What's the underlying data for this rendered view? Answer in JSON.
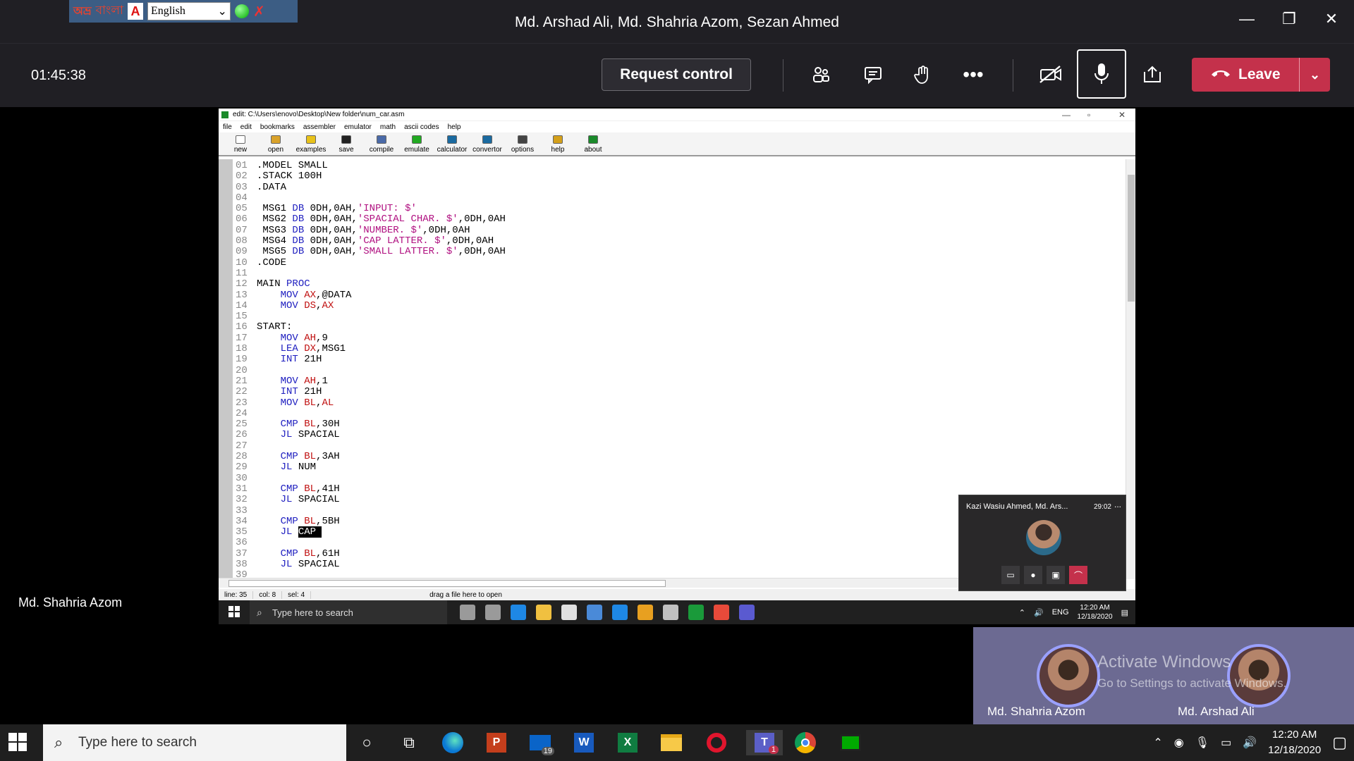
{
  "window": {
    "title": "Md. Arshad Ali, Md. Shahria Azom, Sezan Ahmed",
    "minimize": "—",
    "restore": "❐",
    "close": "✕"
  },
  "lang_bar": {
    "logo": "অভ্র",
    "name": "বাংলা",
    "adobe": "A",
    "selected": "English"
  },
  "call": {
    "timer": "01:45:38",
    "request_control": "Request control",
    "leave": "Leave",
    "presenter_name": "Md. Shahria Azom"
  },
  "editor": {
    "title": "edit: C:\\Users\\enovo\\Desktop\\New folder\\num_car.asm",
    "menu": [
      "file",
      "edit",
      "bookmarks",
      "assembler",
      "emulator",
      "math",
      "ascii codes",
      "help"
    ],
    "tools": [
      {
        "label": "new",
        "color": "#ffffff"
      },
      {
        "label": "open",
        "color": "#d9a22a"
      },
      {
        "label": "examples",
        "color": "#e8c21a"
      },
      {
        "label": "save",
        "color": "#222222"
      },
      {
        "label": "compile",
        "color": "#4a6aa8"
      },
      {
        "label": "emulate",
        "color": "#22aa22"
      },
      {
        "label": "calculator",
        "color": "#1a6aa0"
      },
      {
        "label": "convertor",
        "color": "#1a6aa0"
      },
      {
        "label": "options",
        "color": "#444444"
      },
      {
        "label": "help",
        "color": "#d4a01a"
      },
      {
        "label": "about",
        "color": "#1a8a2a"
      }
    ],
    "lines": [
      [
        {
          "t": ".MODEL SMALL",
          "c": "#000"
        }
      ],
      [
        {
          "t": ".STACK 100H",
          "c": "#000"
        }
      ],
      [
        {
          "t": ".DATA",
          "c": "#000"
        }
      ],
      [],
      [
        {
          "t": " MSG1 ",
          "c": "#000"
        },
        {
          "t": "DB",
          "c": "#2020c0"
        },
        {
          "t": " 0DH,0AH,",
          "c": "#000"
        },
        {
          "t": "'INPUT: $'",
          "c": "#b01080"
        }
      ],
      [
        {
          "t": " MSG2 ",
          "c": "#000"
        },
        {
          "t": "DB",
          "c": "#2020c0"
        },
        {
          "t": " 0DH,0AH,",
          "c": "#000"
        },
        {
          "t": "'SPACIAL CHAR. $'",
          "c": "#b01080"
        },
        {
          "t": ",0DH,0AH",
          "c": "#000"
        }
      ],
      [
        {
          "t": " MSG3 ",
          "c": "#000"
        },
        {
          "t": "DB",
          "c": "#2020c0"
        },
        {
          "t": " 0DH,0AH,",
          "c": "#000"
        },
        {
          "t": "'NUMBER. $'",
          "c": "#b01080"
        },
        {
          "t": ",0DH,0AH",
          "c": "#000"
        }
      ],
      [
        {
          "t": " MSG4 ",
          "c": "#000"
        },
        {
          "t": "DB",
          "c": "#2020c0"
        },
        {
          "t": " 0DH,0AH,",
          "c": "#000"
        },
        {
          "t": "'CAP LATTER. $'",
          "c": "#b01080"
        },
        {
          "t": ",0DH,0AH",
          "c": "#000"
        }
      ],
      [
        {
          "t": " MSG5 ",
          "c": "#000"
        },
        {
          "t": "DB",
          "c": "#2020c0"
        },
        {
          "t": " 0DH,0AH,",
          "c": "#000"
        },
        {
          "t": "'SMALL LATTER. $'",
          "c": "#b01080"
        },
        {
          "t": ",0DH,0AH",
          "c": "#000"
        }
      ],
      [
        {
          "t": ".CODE",
          "c": "#000"
        }
      ],
      [],
      [
        {
          "t": "MAIN ",
          "c": "#000"
        },
        {
          "t": "PROC",
          "c": "#2020c0"
        }
      ],
      [
        {
          "t": "    ",
          "c": "#000"
        },
        {
          "t": "MOV",
          "c": "#2020c0"
        },
        {
          "t": " ",
          "c": "#000"
        },
        {
          "t": "AX",
          "c": "#c01010"
        },
        {
          "t": ",@DATA",
          "c": "#000"
        }
      ],
      [
        {
          "t": "    ",
          "c": "#000"
        },
        {
          "t": "MOV",
          "c": "#2020c0"
        },
        {
          "t": " ",
          "c": "#000"
        },
        {
          "t": "DS",
          "c": "#c01010"
        },
        {
          "t": ",",
          "c": "#000"
        },
        {
          "t": "AX",
          "c": "#c01010"
        }
      ],
      [],
      [
        {
          "t": "START:",
          "c": "#000"
        }
      ],
      [
        {
          "t": "    ",
          "c": "#000"
        },
        {
          "t": "MOV",
          "c": "#2020c0"
        },
        {
          "t": " ",
          "c": "#000"
        },
        {
          "t": "AH",
          "c": "#c01010"
        },
        {
          "t": ",9",
          "c": "#000"
        }
      ],
      [
        {
          "t": "    ",
          "c": "#000"
        },
        {
          "t": "LEA",
          "c": "#2020c0"
        },
        {
          "t": " ",
          "c": "#000"
        },
        {
          "t": "DX",
          "c": "#c01010"
        },
        {
          "t": ",MSG1",
          "c": "#000"
        }
      ],
      [
        {
          "t": "    ",
          "c": "#000"
        },
        {
          "t": "INT",
          "c": "#2020c0"
        },
        {
          "t": " 21H",
          "c": "#000"
        }
      ],
      [],
      [
        {
          "t": "    ",
          "c": "#000"
        },
        {
          "t": "MOV",
          "c": "#2020c0"
        },
        {
          "t": " ",
          "c": "#000"
        },
        {
          "t": "AH",
          "c": "#c01010"
        },
        {
          "t": ",1",
          "c": "#000"
        }
      ],
      [
        {
          "t": "    ",
          "c": "#000"
        },
        {
          "t": "INT",
          "c": "#2020c0"
        },
        {
          "t": " 21H",
          "c": "#000"
        }
      ],
      [
        {
          "t": "    ",
          "c": "#000"
        },
        {
          "t": "MOV",
          "c": "#2020c0"
        },
        {
          "t": " ",
          "c": "#000"
        },
        {
          "t": "BL",
          "c": "#c01010"
        },
        {
          "t": ",",
          "c": "#000"
        },
        {
          "t": "AL",
          "c": "#c01010"
        }
      ],
      [],
      [
        {
          "t": "    ",
          "c": "#000"
        },
        {
          "t": "CMP",
          "c": "#2020c0"
        },
        {
          "t": " ",
          "c": "#000"
        },
        {
          "t": "BL",
          "c": "#c01010"
        },
        {
          "t": ",30H",
          "c": "#000"
        }
      ],
      [
        {
          "t": "    ",
          "c": "#000"
        },
        {
          "t": "JL",
          "c": "#2020c0"
        },
        {
          "t": " SPACIAL",
          "c": "#000"
        }
      ],
      [],
      [
        {
          "t": "    ",
          "c": "#000"
        },
        {
          "t": "CMP",
          "c": "#2020c0"
        },
        {
          "t": " ",
          "c": "#000"
        },
        {
          "t": "BL",
          "c": "#c01010"
        },
        {
          "t": ",3AH",
          "c": "#000"
        }
      ],
      [
        {
          "t": "    ",
          "c": "#000"
        },
        {
          "t": "JL",
          "c": "#2020c0"
        },
        {
          "t": " NUM",
          "c": "#000"
        }
      ],
      [],
      [
        {
          "t": "    ",
          "c": "#000"
        },
        {
          "t": "CMP",
          "c": "#2020c0"
        },
        {
          "t": " ",
          "c": "#000"
        },
        {
          "t": "BL",
          "c": "#c01010"
        },
        {
          "t": ",41H",
          "c": "#000"
        }
      ],
      [
        {
          "t": "    ",
          "c": "#000"
        },
        {
          "t": "JL",
          "c": "#2020c0"
        },
        {
          "t": " SPACIAL",
          "c": "#000"
        }
      ],
      [],
      [
        {
          "t": "    ",
          "c": "#000"
        },
        {
          "t": "CMP",
          "c": "#2020c0"
        },
        {
          "t": " ",
          "c": "#000"
        },
        {
          "t": "BL",
          "c": "#c01010"
        },
        {
          "t": ",5BH",
          "c": "#000"
        }
      ],
      [
        {
          "t": "    ",
          "c": "#000"
        },
        {
          "t": "JL",
          "c": "#2020c0"
        },
        {
          "t": " ",
          "c": "#000"
        },
        {
          "t": "CAP ",
          "c": "#fff",
          "sel": true
        }
      ],
      [],
      [
        {
          "t": "    ",
          "c": "#000"
        },
        {
          "t": "CMP",
          "c": "#2020c0"
        },
        {
          "t": " ",
          "c": "#000"
        },
        {
          "t": "BL",
          "c": "#c01010"
        },
        {
          "t": ",61H",
          "c": "#000"
        }
      ],
      [
        {
          "t": "    ",
          "c": "#000"
        },
        {
          "t": "JL",
          "c": "#2020c0"
        },
        {
          "t": " SPACIAL",
          "c": "#000"
        }
      ],
      []
    ],
    "status": {
      "line": "line: 35",
      "col": "col: 8",
      "sel": "sel: 4",
      "hint": "drag a file here to open"
    }
  },
  "inner_taskbar": {
    "search_placeholder": "Type here to search",
    "lang": "ENG",
    "time": "12:20 AM",
    "date": "12/18/2020",
    "icons": [
      "#9a9a9a",
      "#9a9a9a",
      "#1e88e5",
      "#f0c040",
      "#e0e0e0",
      "#4a8ad8",
      "#1e88e5",
      "#e8a020",
      "#c0c0c0",
      "#1a9a3a",
      "#e84a3a",
      "#5a5ad0"
    ]
  },
  "mini_window": {
    "title": "Kazi Wasiu Ahmed, Md. Ars...",
    "time": "29:02",
    "more": "..."
  },
  "participants": {
    "p1": "Md. Shahria Azom",
    "p2": "Md. Arshad Ali",
    "watermark1": "Activate Windows",
    "watermark2": "Go to Settings to activate Windows."
  },
  "taskbar": {
    "search_placeholder": "Type here to search",
    "mail_badge": "19",
    "teams_badge": "1",
    "time": "12:20 AM",
    "date": "12/18/2020"
  }
}
